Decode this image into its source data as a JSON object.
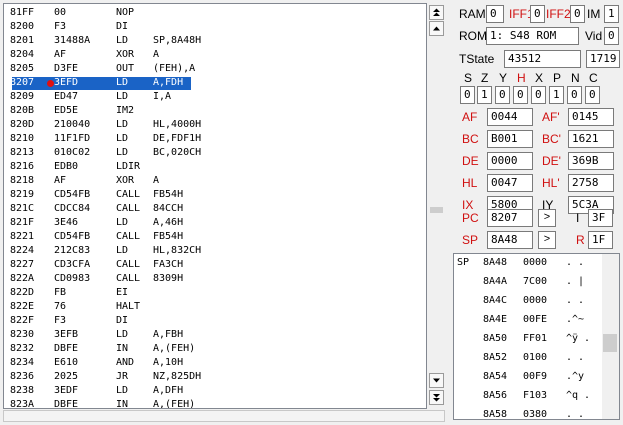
{
  "disasm": {
    "rows": [
      {
        "addr": "81FF",
        "bytes": "00",
        "mnem": "NOP",
        "ops": ""
      },
      {
        "addr": "8200",
        "bytes": "F3",
        "mnem": "DI",
        "ops": ""
      },
      {
        "addr": "8201",
        "bytes": "31488A",
        "mnem": "LD",
        "ops": "SP,8A48H"
      },
      {
        "addr": "8204",
        "bytes": "AF",
        "mnem": "XOR",
        "ops": "A"
      },
      {
        "addr": "8205",
        "bytes": "D3FE",
        "mnem": "OUT",
        "ops": "(FEH),A"
      },
      {
        "addr": "8207",
        "bytes": "3EFD",
        "mnem": "LD",
        "ops": "A,FDH"
      },
      {
        "addr": "8209",
        "bytes": "ED47",
        "mnem": "LD",
        "ops": "I,A"
      },
      {
        "addr": "820B",
        "bytes": "ED5E",
        "mnem": "IM2",
        "ops": ""
      },
      {
        "addr": "820D",
        "bytes": "210040",
        "mnem": "LD",
        "ops": "HL,4000H"
      },
      {
        "addr": "8210",
        "bytes": "11F1FD",
        "mnem": "LD",
        "ops": "DE,FDF1H"
      },
      {
        "addr": "8213",
        "bytes": "010C02",
        "mnem": "LD",
        "ops": "BC,020CH"
      },
      {
        "addr": "8216",
        "bytes": "EDB0",
        "mnem": "LDIR",
        "ops": ""
      },
      {
        "addr": "8218",
        "bytes": "AF",
        "mnem": "XOR",
        "ops": "A"
      },
      {
        "addr": "8219",
        "bytes": "CD54FB",
        "mnem": "CALL",
        "ops": "FB54H"
      },
      {
        "addr": "821C",
        "bytes": "CDCC84",
        "mnem": "CALL",
        "ops": "84CCH"
      },
      {
        "addr": "821F",
        "bytes": "3E46",
        "mnem": "LD",
        "ops": "A,46H"
      },
      {
        "addr": "8221",
        "bytes": "CD54FB",
        "mnem": "CALL",
        "ops": "FB54H"
      },
      {
        "addr": "8224",
        "bytes": "212C83",
        "mnem": "LD",
        "ops": "HL,832CH"
      },
      {
        "addr": "8227",
        "bytes": "CD3CFA",
        "mnem": "CALL",
        "ops": "FA3CH"
      },
      {
        "addr": "822A",
        "bytes": "CD0983",
        "mnem": "CALL",
        "ops": "8309H"
      },
      {
        "addr": "822D",
        "bytes": "FB",
        "mnem": "EI",
        "ops": ""
      },
      {
        "addr": "822E",
        "bytes": "76",
        "mnem": "HALT",
        "ops": ""
      },
      {
        "addr": "822F",
        "bytes": "F3",
        "mnem": "DI",
        "ops": ""
      },
      {
        "addr": "8230",
        "bytes": "3EFB",
        "mnem": "LD",
        "ops": "A,FBH"
      },
      {
        "addr": "8232",
        "bytes": "DBFE",
        "mnem": "IN",
        "ops": "A,(FEH)"
      },
      {
        "addr": "8234",
        "bytes": "E610",
        "mnem": "AND",
        "ops": "A,10H"
      },
      {
        "addr": "8236",
        "bytes": "2025",
        "mnem": "JR",
        "ops": "NZ,825DH"
      },
      {
        "addr": "8238",
        "bytes": "3EDF",
        "mnem": "LD",
        "ops": "A,DFH"
      },
      {
        "addr": "823A",
        "bytes": "DBFE",
        "mnem": "IN",
        "ops": "A,(FEH)"
      }
    ],
    "selected_index": 5,
    "breakpoint_index": 5
  },
  "scroll_icons": {
    "top": "double-up-arrow-icon",
    "up": "up-arrow-icon",
    "down": "down-arrow-icon",
    "bottom": "double-down-arrow-icon"
  },
  "top": {
    "ram_label": "RAM",
    "ram_value": "0",
    "iff1_label": "IFF1",
    "iff1_value": "0",
    "iff2_label": "IFF2",
    "iff2_value": "0",
    "im_label": "IM",
    "im_value": "1",
    "rom_label": "ROM",
    "rom_value": "1: S48 ROM",
    "vid_label": "Vid",
    "vid_value": "0",
    "tstate_label": "TState",
    "tstate_value": "43512",
    "tstate_extra": "1719"
  },
  "flags": {
    "names": [
      "S",
      "Z",
      "Y",
      "H",
      "X",
      "P",
      "N",
      "C"
    ],
    "values": [
      "0",
      "1",
      "0",
      "0",
      "0",
      "1",
      "0",
      "0"
    ]
  },
  "regs": [
    {
      "l1": "AF",
      "v1": "0044",
      "l2": "AF'",
      "v2": "0145"
    },
    {
      "l1": "BC",
      "v1": "B001",
      "l2": "BC'",
      "v2": "1621"
    },
    {
      "l1": "DE",
      "v1": "0000",
      "l2": "DE'",
      "v2": "369B"
    },
    {
      "l1": "HL",
      "v1": "0047",
      "l2": "HL'",
      "v2": "2758"
    },
    {
      "l1": "IX",
      "v1": "5800",
      "l2": "IY",
      "v2": "5C3A"
    }
  ],
  "pc": {
    "label": "PC",
    "value": "8207",
    "btn": ">",
    "i_label": "I",
    "i_value": "3F"
  },
  "sp": {
    "label": "SP",
    "value": "8A48",
    "btn": ">",
    "r_label": "R",
    "r_value": "1F"
  },
  "colors": {
    "accent_red": "#d01010",
    "selection": "#1a63c6"
  },
  "memory": {
    "rows": [
      {
        "tag": "SP",
        "addr": "8A48",
        "val": "0000",
        "ch": ". ."
      },
      {
        "tag": "",
        "addr": "8A4A",
        "val": "7C00",
        "ch": ". |"
      },
      {
        "tag": "",
        "addr": "8A4C",
        "val": "0000",
        "ch": ". ."
      },
      {
        "tag": "",
        "addr": "8A4E",
        "val": "00FE",
        "ch": ".^~"
      },
      {
        "tag": "",
        "addr": "8A50",
        "val": "FF01",
        "ch": "^ÿ ."
      },
      {
        "tag": "",
        "addr": "8A52",
        "val": "0100",
        "ch": ". ."
      },
      {
        "tag": "",
        "addr": "8A54",
        "val": "00F9",
        "ch": ".^y"
      },
      {
        "tag": "",
        "addr": "8A56",
        "val": "F103",
        "ch": "^q ."
      },
      {
        "tag": "",
        "addr": "8A58",
        "val": "0380",
        "ch": ". ."
      }
    ]
  }
}
